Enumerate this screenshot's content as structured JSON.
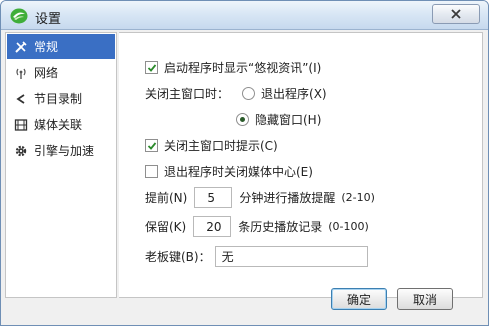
{
  "window": {
    "title": "设置"
  },
  "sidebar": {
    "items": [
      {
        "label": "常规",
        "icon": "wrench-icon",
        "active": true
      },
      {
        "label": "网络",
        "icon": "antenna-icon",
        "active": false
      },
      {
        "label": "节目录制",
        "icon": "share-icon",
        "active": false
      },
      {
        "label": "媒体关联",
        "icon": "film-icon",
        "active": false
      },
      {
        "label": "引擎与加速",
        "icon": "gear-icon",
        "active": false
      }
    ]
  },
  "general": {
    "show_news_on_start": {
      "label": "启动程序时显示“悠视资讯”(I)",
      "checked": true
    },
    "close_behavior": {
      "label": "关闭主窗口时：",
      "options": [
        {
          "label": "退出程序(X)",
          "selected": false
        },
        {
          "label": "隐藏窗口(H)",
          "selected": true
        }
      ]
    },
    "prompt_on_close": {
      "label": "关闭主窗口时提示(C)",
      "checked": true
    },
    "close_media_center": {
      "label": "退出程序时关闭媒体中心(E)",
      "checked": false
    },
    "remind": {
      "prefix": "提前(N)",
      "value": "5",
      "suffix": "分钟进行播放提醒",
      "range": "(2-10)"
    },
    "history": {
      "prefix": "保留(K)",
      "value": "20",
      "suffix": "条历史播放记录",
      "range": "(0-100)"
    },
    "boss_key": {
      "label": "老板键(B)：",
      "value": "无"
    }
  },
  "buttons": {
    "ok": "确定",
    "cancel": "取消"
  },
  "colors": {
    "accent": "#3a6fc4",
    "check": "#2b8a2b"
  }
}
